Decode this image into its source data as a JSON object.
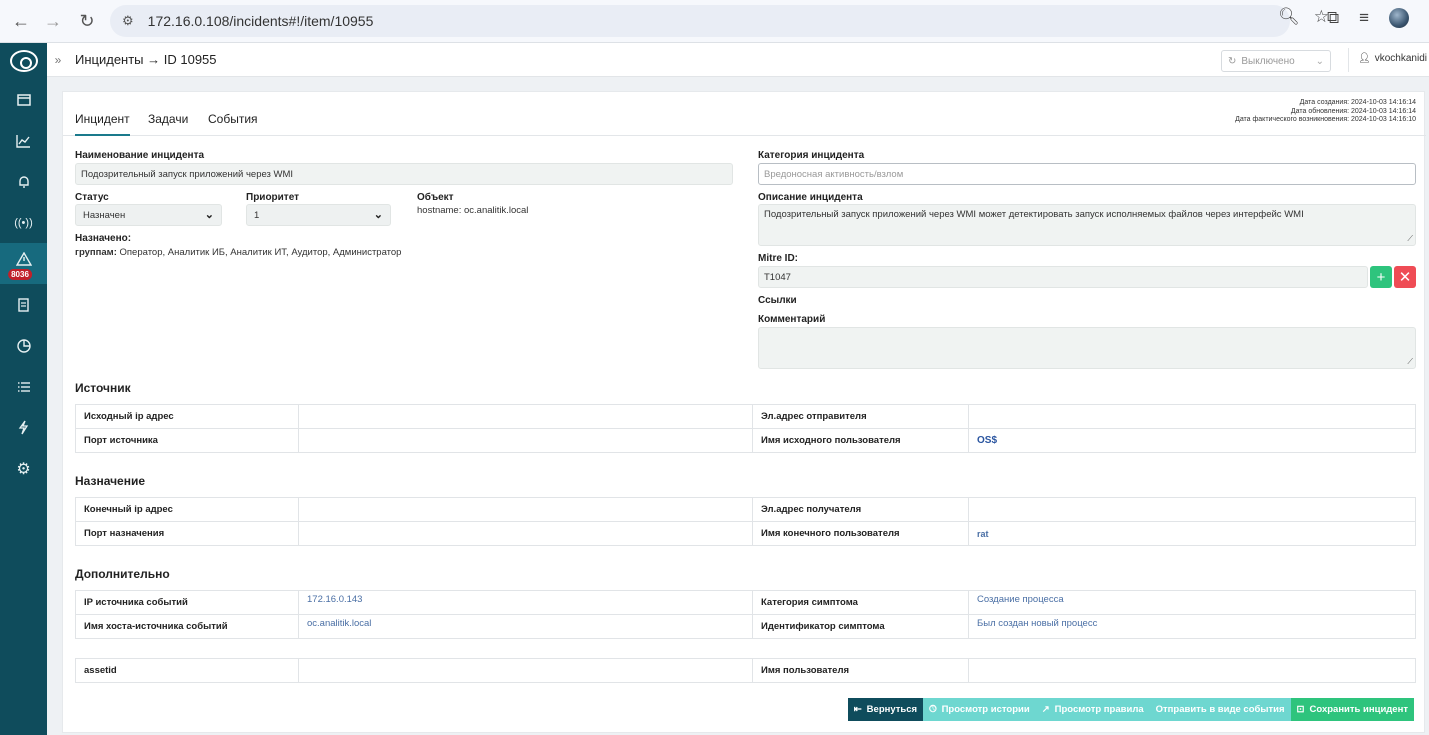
{
  "browser": {
    "url": "172.16.0.108/incidents#!/item/10955"
  },
  "sidebar": {
    "badge": "8036"
  },
  "header": {
    "breadcrumb": "Инциденты → ID 10955",
    "toggle_value": "Выключено",
    "user": "vkochkanidi"
  },
  "tabs": [
    {
      "label": "Инцидент",
      "active": true
    },
    {
      "label": "Задачи",
      "active": false
    },
    {
      "label": "События",
      "active": false
    }
  ],
  "dates": {
    "created": "Дата создания: 2024-10-03 14:16:14",
    "updated": "Дата обновления: 2024-10-03 14:16:14",
    "occurred": "Дата фактического возникновения: 2024-10-03 14:16:10"
  },
  "form": {
    "name_label": "Наименование инцидента",
    "name_value": "Подозрительный запуск приложений через WMI",
    "status_label": "Статус",
    "status_value": "Назначен",
    "priority_label": "Приоритет",
    "priority_value": "1",
    "object_label": "Объект",
    "object_value": "hostname: oc.analitik.local",
    "assigned_label": "Назначено:",
    "assigned_groups_label": "группам:",
    "assigned_groups_value": "Оператор, Аналитик ИБ, Аналитик ИТ, Аудитор, Администратор",
    "category_label": "Категория инцидента",
    "category_placeholder": "Вредоносная активность/взлом",
    "description_label": "Описание инцидента",
    "description_value": "Подозрительный запуск приложений через WMI может детектировать запуск исполняемых файлов через интерфейс WMI",
    "mitre_label": "Mitre ID:",
    "mitre_value": "T1047",
    "links_label": "Ссылки",
    "comment_label": "Комментарий"
  },
  "source": {
    "title": "Источник",
    "ip_label": "Исходный ip адрес",
    "ip_value": "",
    "port_label": "Порт источника",
    "port_value": "",
    "email_label": "Эл.адрес отправителя",
    "email_value": "",
    "user_label": "Имя исходного пользователя",
    "user_value": "OS$"
  },
  "destination": {
    "title": "Назначение",
    "ip_label": "Конечный ip адрес",
    "ip_value": "",
    "port_label": "Порт назначения",
    "port_value": "",
    "email_label": "Эл.адрес получателя",
    "email_value": "",
    "user_label": "Имя конечного пользователя",
    "user_value": "rat"
  },
  "extra": {
    "title": "Дополнительно",
    "event_ip_label": "IP источника событий",
    "event_ip_value": "172.16.0.143",
    "event_host_label": "Имя хоста-источника событий",
    "event_host_value": "oc.analitik.local",
    "symptom_cat_label": "Категория симптома",
    "symptom_cat_value": "Создание процесса",
    "symptom_id_label": "Идентификатор симптома",
    "symptom_id_value": "Был создан новый процесс",
    "assetid_label": "assetid",
    "assetid_value": "",
    "username_label": "Имя пользователя",
    "username_value": ""
  },
  "actions": {
    "back": "Вернуться",
    "history": "Просмотр истории",
    "rule": "Просмотр правила",
    "send_event": "Отправить в виде события",
    "save": "Сохранить инцидент"
  }
}
